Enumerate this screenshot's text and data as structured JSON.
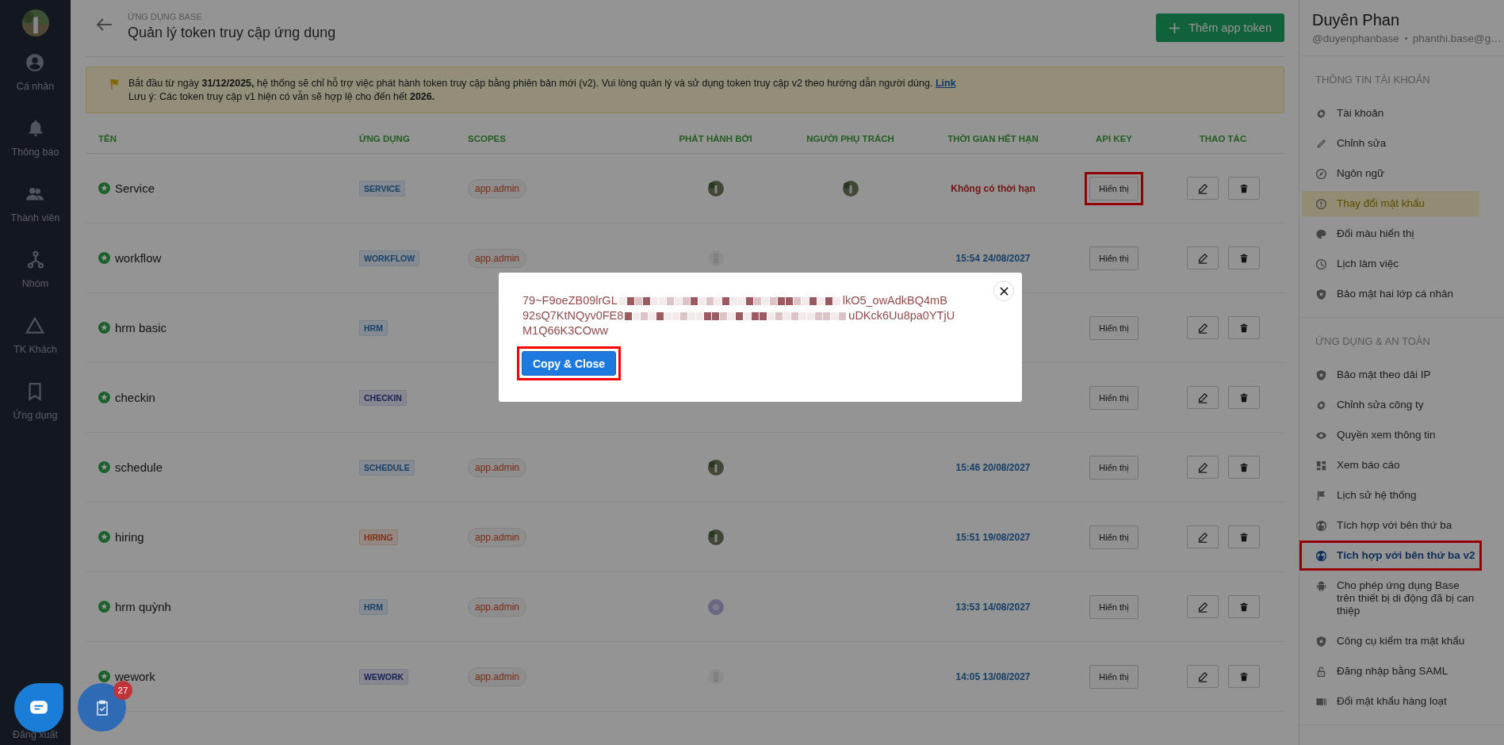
{
  "nav": {
    "items": [
      {
        "label": "Cá nhân"
      },
      {
        "label": "Thông báo"
      },
      {
        "label": "Thành viên"
      },
      {
        "label": "Nhóm"
      },
      {
        "label": "TK Khách"
      },
      {
        "label": "Ứng dụng"
      }
    ],
    "logout": "Đăng xuất"
  },
  "header": {
    "breadcrumb": "ỨNG DỤNG BASE",
    "title": "Quản lý token truy cập ứng dụng",
    "add_button": "Thêm app token"
  },
  "notice": {
    "line1": "Bắt đầu từ ngày **31/12/2025,** hệ thống sẽ chỉ hỗ trợ việc phát hành token truy cập bằng phiên bản mới (v2). Vui lòng quản lý và sử dụng token truy cập v2 theo hướng dẫn người dùng.",
    "link": "Link",
    "line2": "Lưu ý: Các token truy cập v1 hiện có vẫn sẽ hợp lệ cho đến hết **2026.**"
  },
  "table": {
    "columns": [
      "TÊN",
      "ỨNG DỤNG",
      "SCOPES",
      "PHÁT HÀNH BỞI",
      "NGƯỜI PHỤ TRÁCH",
      "THỜI GIAN HẾT HẠN",
      "API KEY",
      "THAO TÁC"
    ],
    "rows": [
      {
        "name": "Service",
        "app": {
          "label": "SERVICE",
          "kind": "blue"
        },
        "scope": "app.admin",
        "issuer": {
          "kind": "photo"
        },
        "owner": {
          "kind": "photo"
        },
        "expiry": {
          "text": "Không có thời hạn",
          "permanent": true
        },
        "api_button": "Hiển thị",
        "annotated": true
      },
      {
        "name": "workflow",
        "app": {
          "label": "WORKFLOW",
          "kind": "blue"
        },
        "scope": "app.admin",
        "issuer": {
          "kind": "doc"
        },
        "expiry": {
          "text": "15:54 24/08/2027",
          "permanent": false
        },
        "api_button": "Hiển thị",
        "annotated": false
      },
      {
        "name": "hrm basic",
        "app": {
          "label": "HRM",
          "kind": "blue"
        },
        "api_button": "Hiển thị",
        "annotated": false
      },
      {
        "name": "checkin",
        "app": {
          "label": "CHECKIN",
          "kind": "navy"
        },
        "api_button": "Hiển thị",
        "annotated": false
      },
      {
        "name": "schedule",
        "app": {
          "label": "SCHEDULE",
          "kind": "blue"
        },
        "scope": "app.admin",
        "issuer": {
          "kind": "photo"
        },
        "expiry": {
          "text": "15:46 20/08/2027",
          "permanent": false
        },
        "api_button": "Hiển thị",
        "annotated": false
      },
      {
        "name": "hiring",
        "app": {
          "label": "HIRING",
          "kind": "orange"
        },
        "scope": "app.admin",
        "issuer": {
          "kind": "photo"
        },
        "expiry": {
          "text": "15:51 19/08/2027",
          "permanent": false
        },
        "api_button": "Hiển thị",
        "annotated": false
      },
      {
        "name": "hrm quỳnh",
        "app": {
          "label": "HRM",
          "kind": "blue"
        },
        "scope": "app.admin",
        "issuer": {
          "kind": "plain"
        },
        "expiry": {
          "text": "13:53 14/08/2027",
          "permanent": false
        },
        "api_button": "Hiển thị",
        "annotated": false
      },
      {
        "name": "wework",
        "app": {
          "label": "WEWORK",
          "kind": "navy"
        },
        "scope": "app.admin",
        "issuer": {
          "kind": "doc"
        },
        "expiry": {
          "text": "14:05 13/08/2027",
          "permanent": false
        },
        "api_button": "Hiển thị",
        "annotated": false
      }
    ]
  },
  "dialog": {
    "token": [
      {
        "start": "79~F9oeZB09lrGL",
        "end": "lkO5_owAdkBQ4mB"
      },
      {
        "start": "92sQ7KtNQyv0FE8",
        "end": "uDKck6Uu8pa0YTjU"
      },
      {
        "start": "M1Q66K3COww"
      }
    ],
    "copy_button": "Copy & Close",
    "annotated": true
  },
  "profile": {
    "name": "Duyên Phan",
    "handle": "@duyenphanbase",
    "email": "phanthi.base@g…"
  },
  "sections": [
    {
      "title": "THÔNG TIN TÀI KHOẢN",
      "items": [
        {
          "label": "Tài khoản",
          "kind": "normal",
          "selected": false,
          "annotated": false
        },
        {
          "label": "Chỉnh sửa",
          "kind": "normal",
          "selected": false,
          "annotated": false
        },
        {
          "label": "Ngôn ngữ",
          "kind": "normal",
          "selected": false,
          "annotated": false
        },
        {
          "label": "Thay đổi mật khẩu",
          "kind": "warning",
          "selected": false,
          "annotated": false
        },
        {
          "label": "Đổi màu hiển thị",
          "kind": "normal",
          "selected": false,
          "annotated": false
        },
        {
          "label": "Lịch làm việc",
          "kind": "normal",
          "selected": false,
          "annotated": false
        },
        {
          "label": "Bảo mật hai lớp cá nhân",
          "kind": "normal",
          "selected": false,
          "annotated": false
        }
      ]
    },
    {
      "title": "ỨNG DỤNG & AN TOÀN",
      "items": [
        {
          "label": "Bảo mật theo dải IP",
          "kind": "normal",
          "selected": false,
          "annotated": false
        },
        {
          "label": "Chỉnh sửa công ty",
          "kind": "normal",
          "selected": false,
          "annotated": false
        },
        {
          "label": "Quyền xem thông tin",
          "kind": "normal",
          "selected": false,
          "annotated": false
        },
        {
          "label": "Xem báo cáo",
          "kind": "normal",
          "selected": false,
          "annotated": false
        },
        {
          "label": "Lịch sử hệ thống",
          "kind": "normal",
          "selected": false,
          "annotated": false
        },
        {
          "label": "Tích hợp với bên thứ ba",
          "kind": "normal",
          "selected": false,
          "annotated": false
        },
        {
          "label": "Tích hợp với bên thứ ba v2",
          "kind": "normal",
          "selected": true,
          "annotated": true
        },
        {
          "label": "Cho phép ứng dụng Base trên thiết bị di động đã bị can thiệp",
          "kind": "normal",
          "selected": false,
          "annotated": false
        },
        {
          "label": "Công cụ kiểm tra mật khẩu",
          "kind": "normal",
          "selected": false,
          "annotated": false
        },
        {
          "label": "Đăng nhập bằng SAML",
          "kind": "normal",
          "selected": false,
          "annotated": false
        },
        {
          "label": "Đổi mật khẩu hàng loạt",
          "kind": "normal",
          "selected": false,
          "annotated": false
        }
      ]
    }
  ],
  "floating": {
    "badge": "27"
  }
}
